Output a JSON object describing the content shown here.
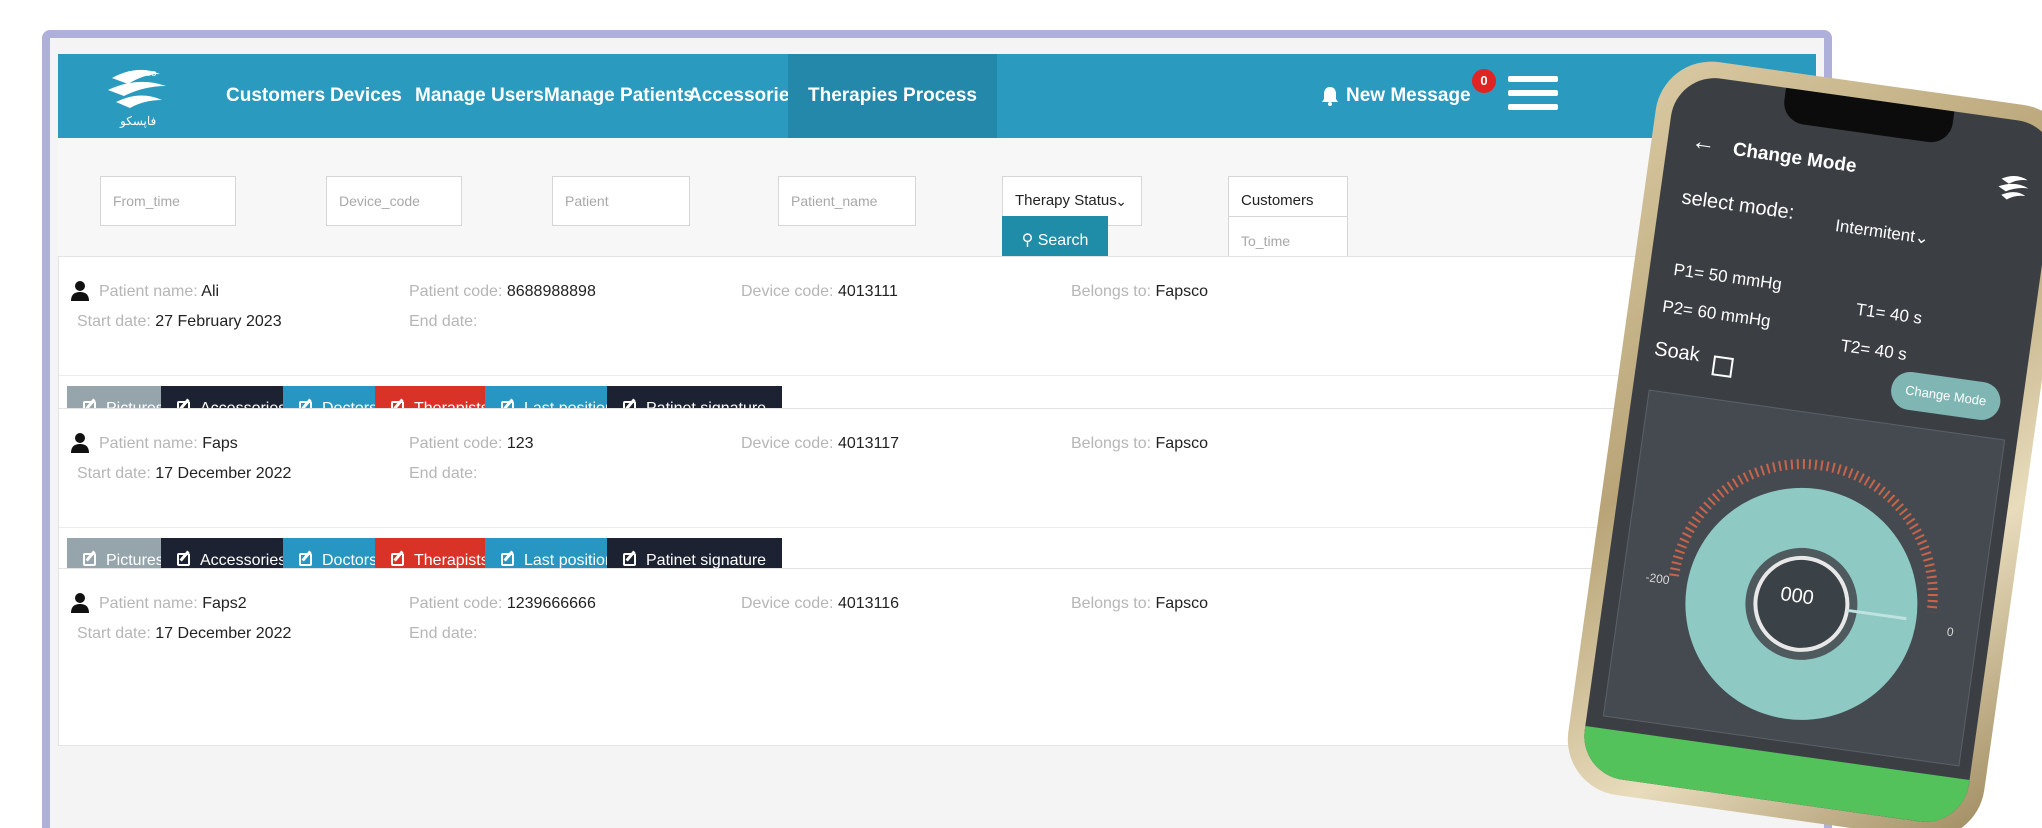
{
  "nav": {
    "logo_text": "فاپسکو",
    "items": [
      "Customers",
      "Devices",
      "Manage Users",
      "Manage Patients",
      "Accessories",
      "Therapies Process"
    ],
    "new_message": "New Message",
    "message_count": "0"
  },
  "filters": {
    "from_time": "From_time",
    "device_code": "Device_code",
    "patient": "Patient",
    "patient_name": "Patient_name",
    "therapy_status": "Therapy Status",
    "customers": "Customers",
    "to_time": "To_time",
    "search": "Search"
  },
  "labels": {
    "patient_name": "Patient name:",
    "start_date": "Start date:",
    "patient_code": "Patient code:",
    "end_date": "End date:",
    "device_code": "Device code:",
    "belongs_to": "Belongs to:"
  },
  "buttons": [
    "Pictures",
    "Accessories",
    "Doctors",
    "Therapists",
    "Last position",
    "Patinet signature"
  ],
  "records": [
    {
      "name": "Ali",
      "start_date": "27 February 2023",
      "patient_code": "8688988898",
      "device_code": "4013111",
      "belongs_to": "Fapsco"
    },
    {
      "name": "Faps",
      "start_date": "17 December 2022",
      "patient_code": "123",
      "device_code": "4013117",
      "belongs_to": "Fapsco"
    },
    {
      "name": "Faps2",
      "start_date": "17 December 2022",
      "patient_code": "1239666666",
      "device_code": "4013116",
      "belongs_to": "Fapsco"
    }
  ],
  "phone": {
    "title": "Change Mode",
    "select_mode": "select mode:",
    "mode_value": "Intermitent",
    "p1": "P1= 50 mmHg",
    "p2": "P2= 60 mmHg",
    "t1": "T1= 40 s",
    "t2": "T2= 40 s",
    "soak": "Soak",
    "change_mode_btn": "Change Mode",
    "gauge_value": "000",
    "gauge_min": "-200",
    "gauge_max": "0"
  }
}
